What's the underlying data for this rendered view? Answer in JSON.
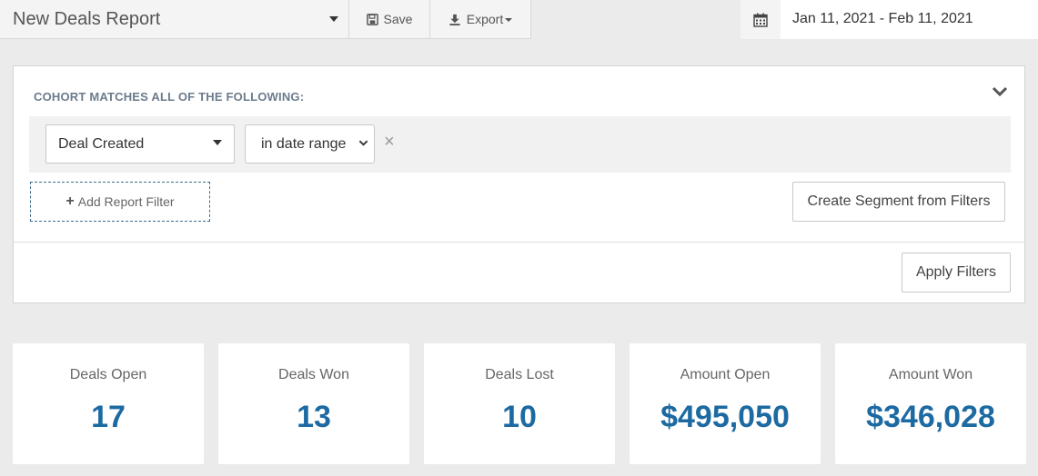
{
  "header": {
    "report_title": "New Deals Report",
    "save_label": "Save",
    "export_label": "Export",
    "date_range": "Jan 11, 2021 - Feb 11, 2021"
  },
  "filters": {
    "heading": "COHORT MATCHES ALL OF THE FOLLOWING:",
    "rows": [
      {
        "field": "Deal Created",
        "operator": "in date range"
      }
    ],
    "remove_symbol": "×",
    "add_filter_label": "Add Report Filter",
    "create_segment_label": "Create Segment from Filters",
    "apply_label": "Apply Filters"
  },
  "stats": [
    {
      "label": "Deals Open",
      "value": "17"
    },
    {
      "label": "Deals Won",
      "value": "13"
    },
    {
      "label": "Deals Lost",
      "value": "10"
    },
    {
      "label": "Amount Open",
      "value": "$495,050"
    },
    {
      "label": "Amount Won",
      "value": "$346,028"
    }
  ],
  "colors": {
    "accent_blue": "#1d6aa3",
    "dashed_border": "#3c6c8c",
    "background": "#ebebeb"
  },
  "icons": [
    "floppy-disk-icon",
    "download-icon",
    "calendar-icon",
    "chevron-down-icon",
    "plus-icon",
    "close-icon"
  ]
}
